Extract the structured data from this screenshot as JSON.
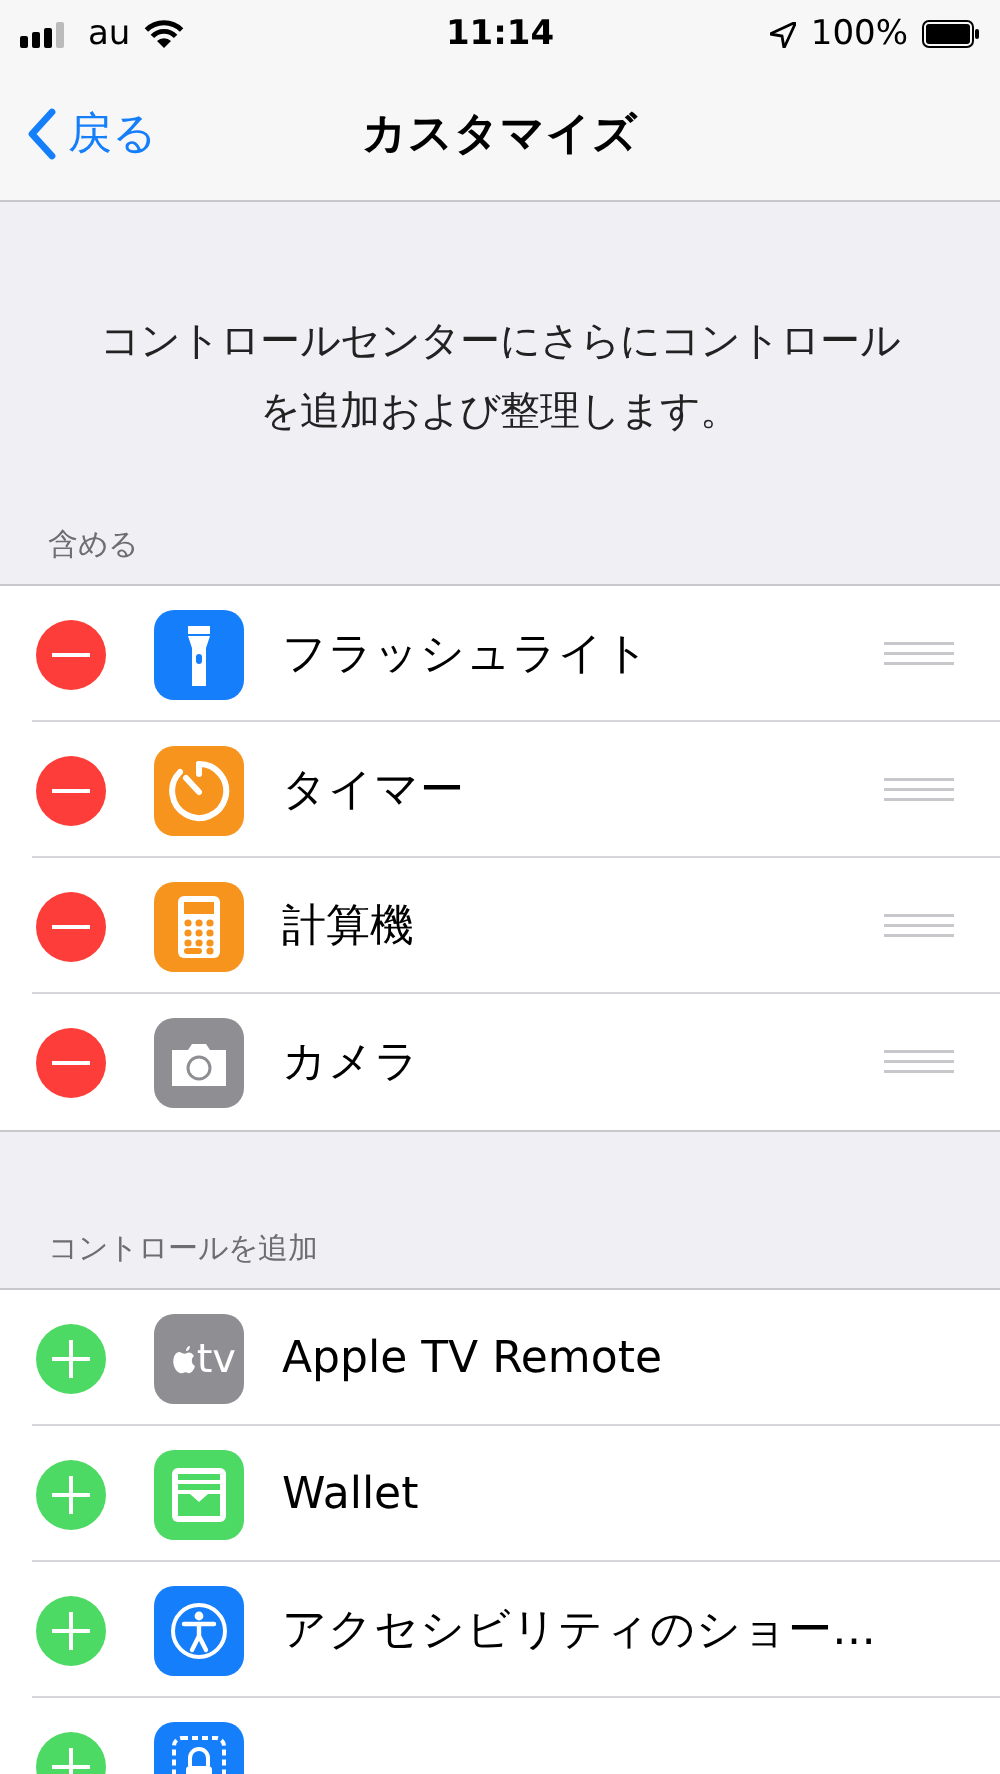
{
  "status_bar": {
    "carrier": "au",
    "time": "11:14",
    "battery": "100%"
  },
  "nav": {
    "back": "戻る",
    "title": "カスタマイズ"
  },
  "description": "コントロールセンターにさらにコントロールを追加および整理します。",
  "sections": [
    {
      "header": "含める",
      "items": [
        {
          "kind": "remove",
          "label": "フラッシュライト"
        },
        {
          "kind": "remove",
          "label": "タイマー"
        },
        {
          "kind": "remove",
          "label": "計算機"
        },
        {
          "kind": "remove",
          "label": "カメラ"
        }
      ]
    },
    {
      "header": "コントロールを追加",
      "items": [
        {
          "kind": "add",
          "icon_text": "tv",
          "label": "Apple TV Remote"
        },
        {
          "kind": "add",
          "label": "Wallet"
        },
        {
          "kind": "add",
          "label": "アクセシビリティのショー…"
        },
        {
          "kind": "add"
        }
      ]
    }
  ]
}
